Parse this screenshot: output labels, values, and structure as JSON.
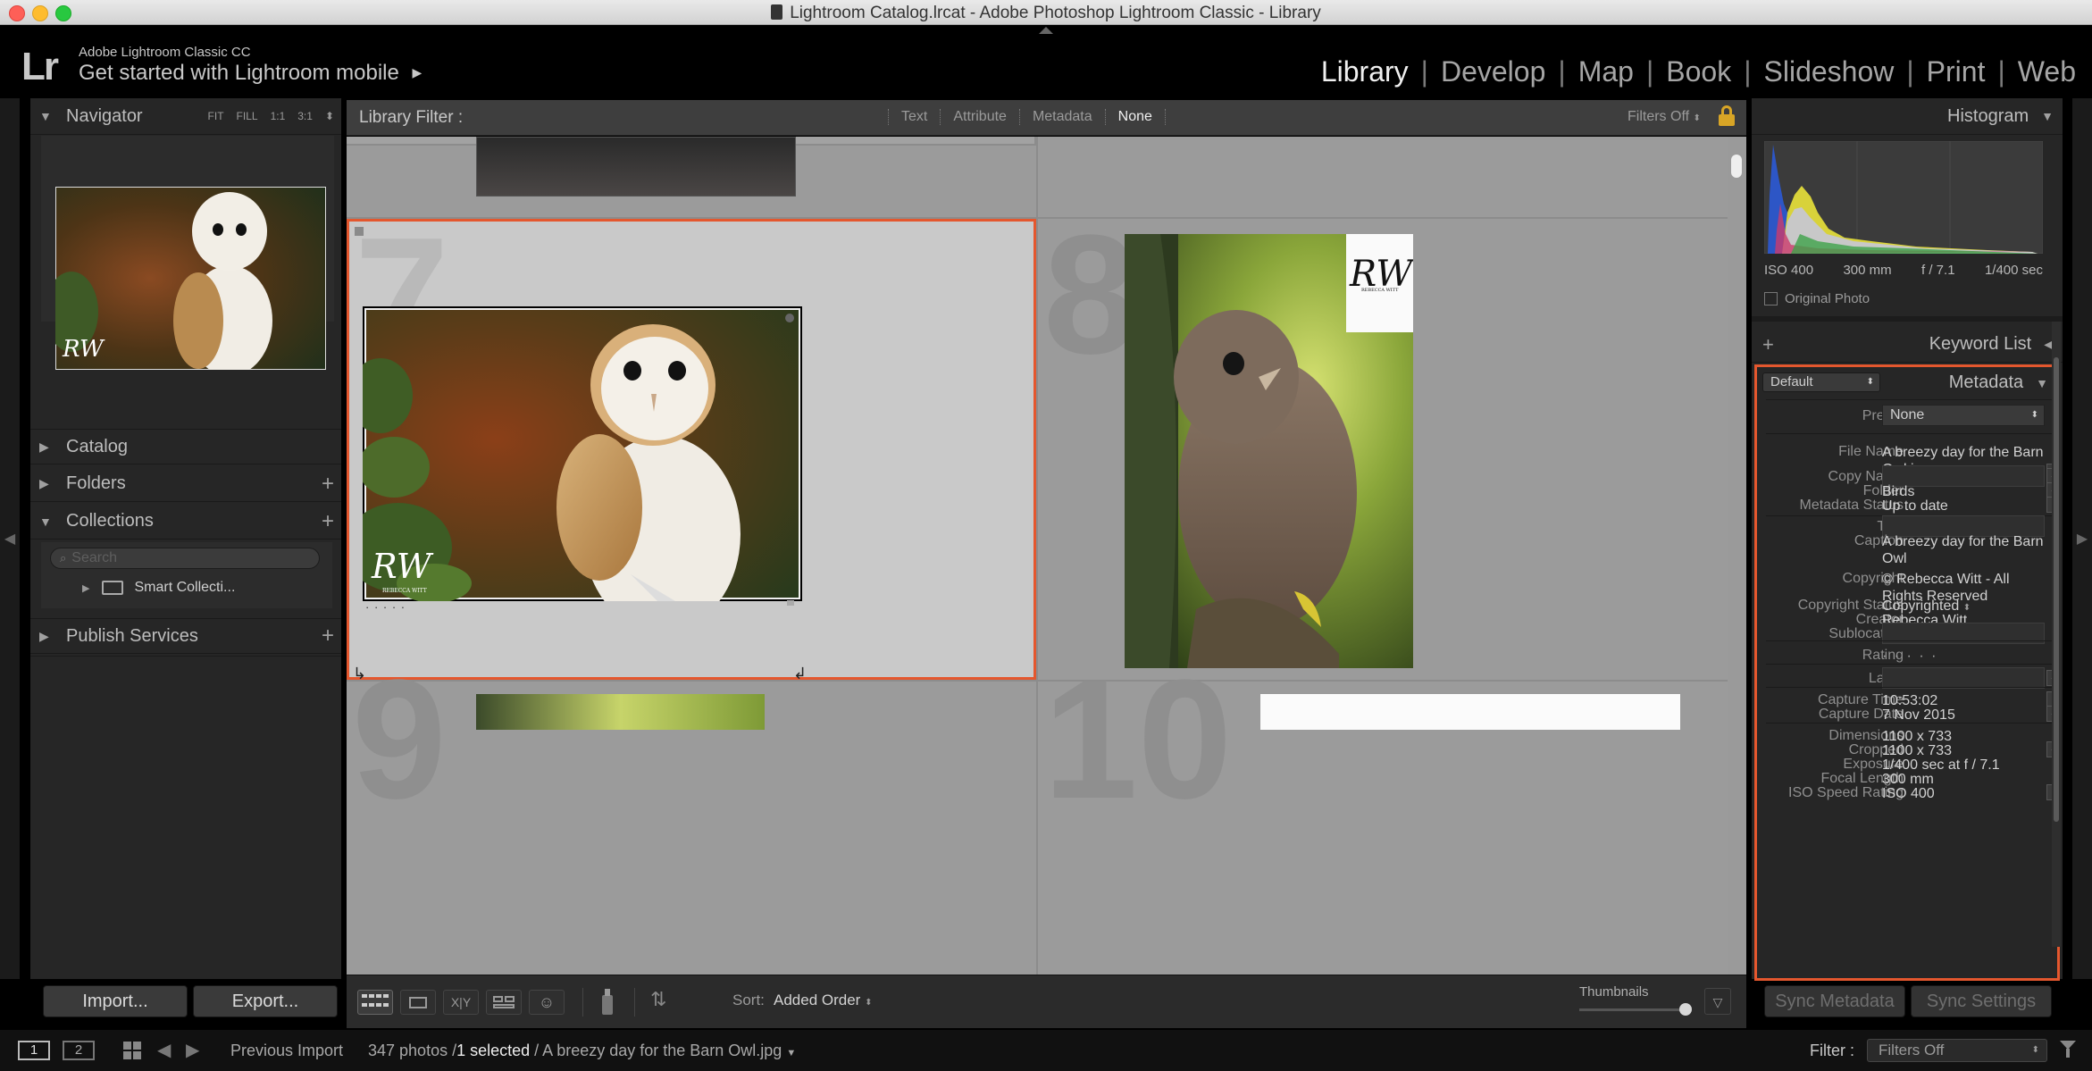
{
  "window": {
    "title": "Lightroom Catalog.lrcat - Adobe Photoshop Lightroom Classic - Library"
  },
  "identity": {
    "logo": "Lr",
    "product": "Adobe Lightroom Classic CC",
    "tagline": "Get started with Lightroom mobile",
    "tagline_arrow": "▶"
  },
  "modules": [
    {
      "label": "Library",
      "active": true
    },
    {
      "label": "Develop"
    },
    {
      "label": "Map"
    },
    {
      "label": "Book"
    },
    {
      "label": "Slideshow"
    },
    {
      "label": "Print"
    },
    {
      "label": "Web"
    }
  ],
  "navigator": {
    "title": "Navigator",
    "zoom_options": [
      "FIT",
      "FILL",
      "1:1",
      "3:1"
    ]
  },
  "left_panels": {
    "catalog": "Catalog",
    "folders": "Folders",
    "collections": "Collections",
    "search_placeholder": "Search",
    "smart_collections": "Smart Collecti...",
    "publish": "Publish Services"
  },
  "left_buttons": {
    "import": "Import...",
    "export": "Export..."
  },
  "filter_bar": {
    "title": "Library Filter :",
    "options": [
      "Text",
      "Attribute",
      "Metadata",
      "None"
    ],
    "active_option": "None",
    "preset": "Filters Off"
  },
  "grid": {
    "cells": [
      {
        "number": "7",
        "selected": true,
        "signature": "RW",
        "signature_sub": "REBECCA WITT",
        "rating": "· · · · ·"
      },
      {
        "number": "8",
        "selected": false,
        "signature": "RW",
        "signature_sub": "REBECCA WITT"
      },
      {
        "number": "9"
      },
      {
        "number": "10"
      }
    ]
  },
  "toolbar": {
    "sort_label": "Sort:",
    "sort_value": "Added Order",
    "thumbnails_label": "Thumbnails"
  },
  "histogram": {
    "title": "Histogram",
    "iso": "ISO 400",
    "focal": "300 mm",
    "aperture": "f / 7.1",
    "shutter": "1/400 sec",
    "original_photo": "Original Photo"
  },
  "keyword_list": {
    "title": "Keyword List",
    "plus": "+"
  },
  "metadata": {
    "title": "Metadata",
    "preset_select": "Default",
    "preset_label": "Preset",
    "preset_value": "None",
    "fields": [
      {
        "label": "File Name",
        "value": "A breezy day for the Barn Owl.jpg"
      },
      {
        "label": "Copy Name",
        "value": ""
      },
      {
        "label": "Folder",
        "value": "Birds"
      },
      {
        "label": "Metadata Status",
        "value": "Up to date"
      },
      {
        "label": "Title",
        "value": ""
      },
      {
        "label": "Caption",
        "value": "A breezy day for the Barn Owl"
      },
      {
        "label": "Copyright",
        "value": "© Rebecca Witt - All Rights Reserved"
      },
      {
        "label": "Copyright Status",
        "value": "Copyrighted"
      },
      {
        "label": "Creator",
        "value": "Rebecca Witt"
      },
      {
        "label": "Sublocation",
        "value": ""
      },
      {
        "label": "Rating",
        "value": "· · · · ·"
      },
      {
        "label": "Label",
        "value": ""
      },
      {
        "label": "Capture Time",
        "value": "10:53:02"
      },
      {
        "label": "Capture Date",
        "value": "7 Nov 2015"
      },
      {
        "label": "Dimensions",
        "value": "1100 x 733"
      },
      {
        "label": "Cropped",
        "value": "1100 x 733"
      },
      {
        "label": "Exposure",
        "value": "1/400 sec at f / 7.1"
      },
      {
        "label": "Focal Length",
        "value": "300 mm"
      },
      {
        "label": "ISO Speed Rating",
        "value": "ISO 400"
      }
    ]
  },
  "right_buttons": {
    "sync_metadata": "Sync Metadata",
    "sync_settings": "Sync Settings"
  },
  "status_bar": {
    "screen1": "1",
    "screen2": "2",
    "source": "Previous Import",
    "count": "347 photos /",
    "selected": "1 selected",
    "filename": "/ A breezy day for the Barn Owl.jpg",
    "filter_label": "Filter :",
    "filter_value": "Filters Off"
  },
  "colors": {
    "accent_selection": "#e4572e",
    "panel": "#262626",
    "grid_bg": "#9b9b9b"
  }
}
